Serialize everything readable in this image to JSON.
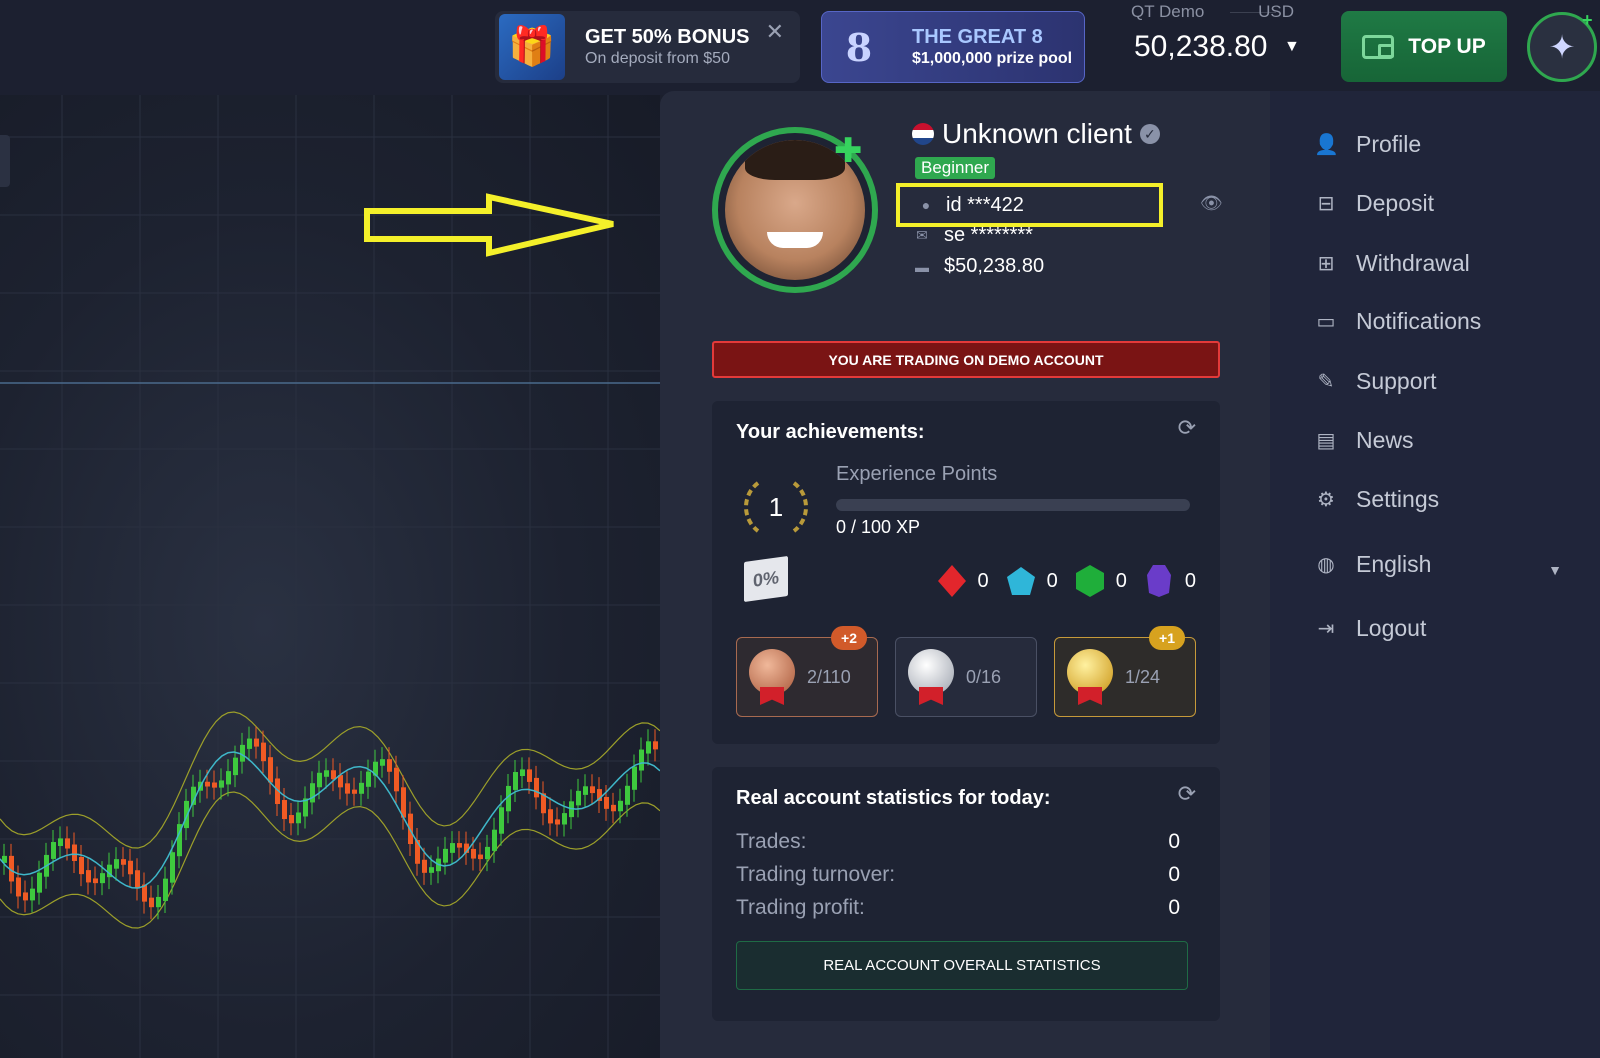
{
  "topbar": {
    "promo_bonus": {
      "title": "GET 50% BONUS",
      "subtitle": "On deposit from $50",
      "close": "✕",
      "icon": "gift-box-icon"
    },
    "promo_great8": {
      "title": "THE GREAT 8",
      "subtitle": "$1,000,000 prize pool",
      "icon": "number-8-icon"
    },
    "account": {
      "type": "QT Demo",
      "currency": "USD",
      "balance": "50,238.80",
      "caret": "▼"
    },
    "topup": {
      "label": "TOP UP",
      "icon": "wallet-icon"
    }
  },
  "profile": {
    "name": "Unknown client",
    "level": "Beginner",
    "id": "id ***422",
    "email": "se ********",
    "funds": "$50,238.80",
    "demo_notice": "YOU ARE TRADING ON DEMO ACCOUNT",
    "verified_mark": "✓",
    "hide_icon": "👁",
    "flag_colors": [
      "#c8102e",
      "#ffffff",
      "#21468b"
    ]
  },
  "achievements": {
    "title": "Your achievements:",
    "level": "1",
    "xp_label": "Experience Points",
    "xp_value": "0 / 100 XP",
    "xp_progress": 0,
    "discount": "0%",
    "gems": [
      {
        "name": "ruby",
        "count": "0",
        "color": "#e3262c"
      },
      {
        "name": "sapphire",
        "count": "0",
        "color": "#2fb6d9"
      },
      {
        "name": "emerald",
        "count": "0",
        "color": "#1fae3a"
      },
      {
        "name": "amethyst",
        "count": "0",
        "color": "#6a3cc9"
      }
    ],
    "medals": [
      {
        "tier": "bronze",
        "count": "2/110",
        "badge": "+2"
      },
      {
        "tier": "silver",
        "count": "0/16",
        "badge": ""
      },
      {
        "tier": "gold",
        "count": "1/24",
        "badge": "+1"
      }
    ]
  },
  "stats": {
    "title": "Real account statistics for today:",
    "trades_label": "Trades:",
    "trades_value": "0",
    "turnover_label": "Trading turnover:",
    "turnover_value": "0",
    "profit_label": "Trading profit:",
    "profit_value": "0",
    "button": "REAL ACCOUNT OVERALL STATISTICS"
  },
  "menu": {
    "items": [
      {
        "label": "Profile",
        "icon": "user-icon"
      },
      {
        "label": "Deposit",
        "icon": "deposit-icon"
      },
      {
        "label": "Withdrawal",
        "icon": "withdrawal-icon"
      },
      {
        "label": "Notifications",
        "icon": "inbox-icon"
      },
      {
        "label": "Support",
        "icon": "support-icon"
      },
      {
        "label": "News",
        "icon": "newspaper-icon"
      },
      {
        "label": "Settings",
        "icon": "gears-icon"
      },
      {
        "label": "English",
        "icon": "globe-icon"
      },
      {
        "label": "Logout",
        "icon": "logout-icon"
      }
    ]
  },
  "colors": {
    "accent_green": "#2fa84f",
    "highlight_yellow": "#f4f02a",
    "demo_red": "#7a1414",
    "candle_up": "#3ec93e",
    "candle_down": "#f05a24"
  }
}
